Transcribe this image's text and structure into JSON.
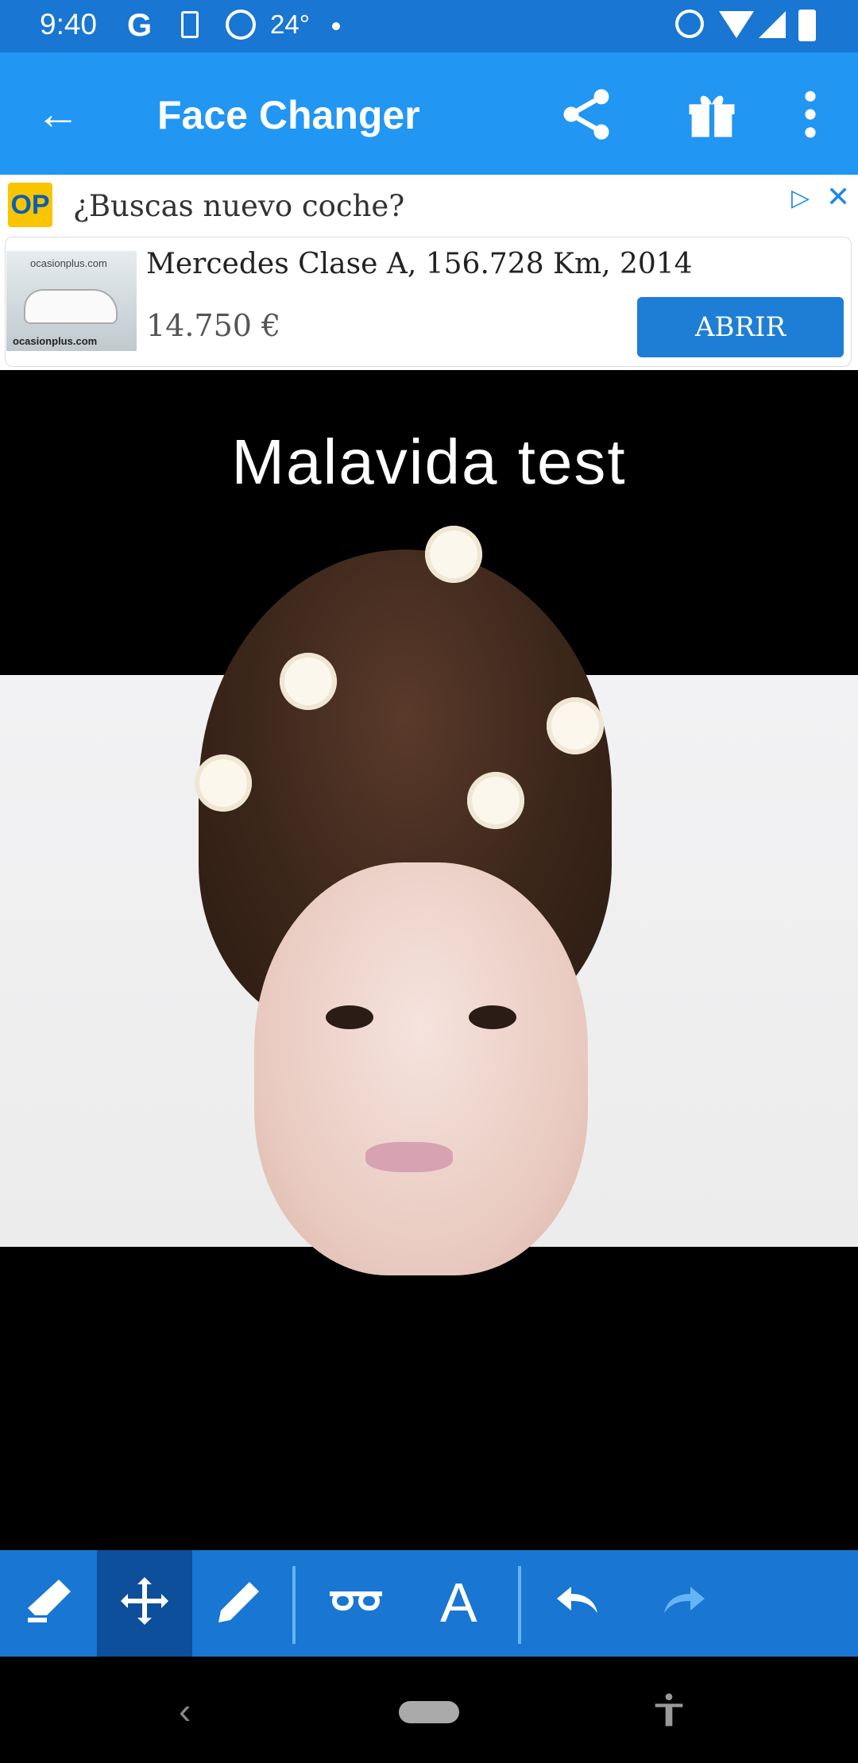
{
  "status_bar": {
    "time": "9:40",
    "google_glyph": "G",
    "temperature": "24°"
  },
  "app_bar": {
    "back_icon": "←",
    "title": "Face Changer",
    "icons": [
      "share-icon",
      "gift-icon",
      "more-vert-icon"
    ]
  },
  "ad": {
    "logo": "OP",
    "headline": "¿Buscas nuevo coche?",
    "brand_top": "ocasionplus.com",
    "brand_bottom": "ocasionplus.com",
    "title": "Mercedes Clase A, 156.728 Km, 2014",
    "price": "14.750 €",
    "cta": "ABRIR",
    "adchoices_icon": "▷",
    "close_icon": "✕"
  },
  "canvas": {
    "caption": "Malavida test"
  },
  "toolbar": {
    "tools": [
      "eraser-icon",
      "move-icon",
      "pencil-icon",
      "glasses-icon",
      "text-icon",
      "undo-icon",
      "redo-icon"
    ],
    "text_tool_glyph": "A",
    "active_tool": "move"
  },
  "nav_bar": {
    "back_glyph": "‹"
  },
  "colors": {
    "status_bar": "#1976d2",
    "app_bar": "#2196f3",
    "toolbar": "#1976d2",
    "toolbar_active": "#0d4f9a",
    "ad_button": "#1e7ed6"
  }
}
